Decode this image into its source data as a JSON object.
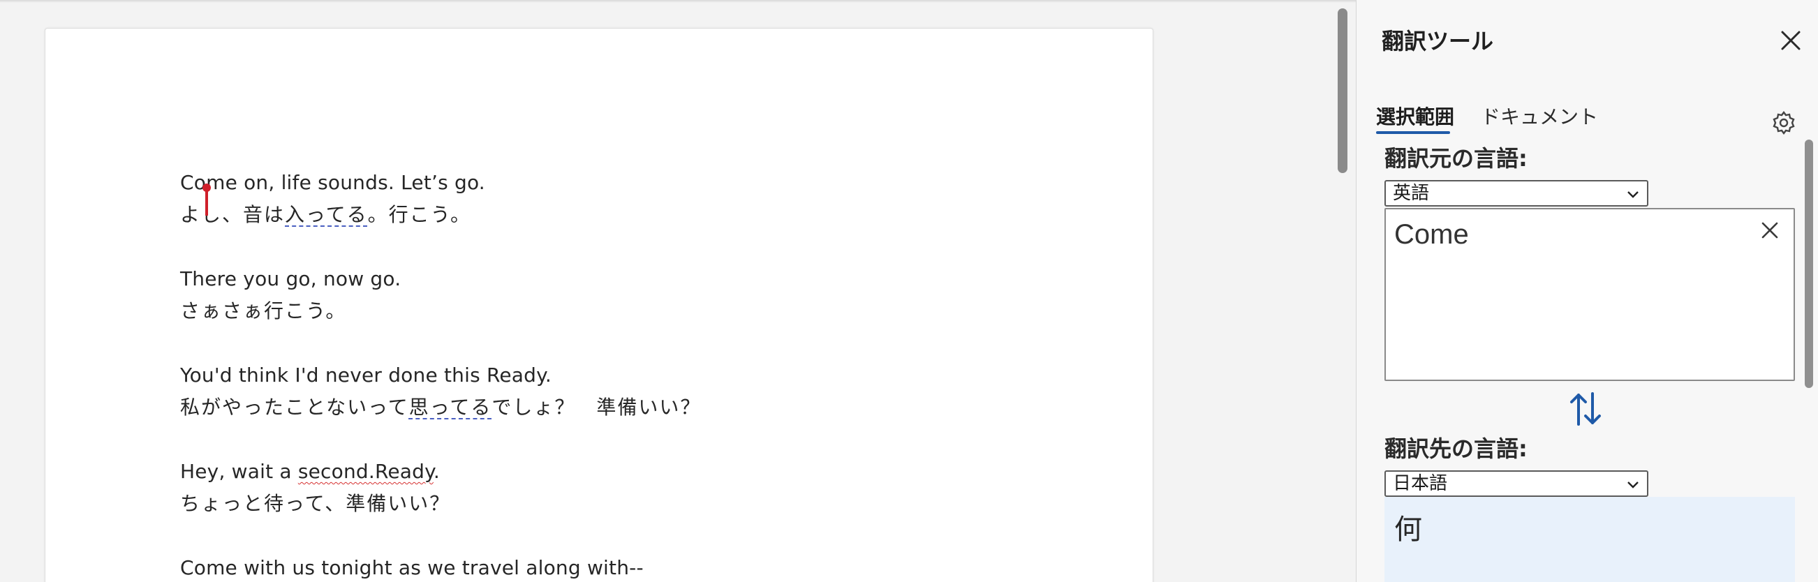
{
  "document": {
    "lines": [
      {
        "id": "l1",
        "parts": [
          "Co",
          "me on, life sounds. Let’s go."
        ]
      },
      {
        "id": "l2",
        "parts": [
          "よし、音は",
          "入ってる",
          "。行こう。"
        ]
      },
      {
        "id": "l3",
        "parts": [
          "There you go, now go."
        ]
      },
      {
        "id": "l4",
        "parts": [
          "さぁさぁ行こう。"
        ]
      },
      {
        "id": "l5",
        "parts": [
          "You'd think I'd never done this Ready."
        ]
      },
      {
        "id": "l6",
        "parts": [
          "私がやったことないって",
          "思ってる",
          "でしょ？　準備いい？"
        ]
      },
      {
        "id": "l7",
        "parts": [
          "Hey, wait a ",
          "second.Ready",
          "."
        ]
      },
      {
        "id": "l8",
        "parts": [
          "ちょっと待って、準備いい？"
        ]
      },
      {
        "id": "l9",
        "parts": [
          "Come with us tonight as we travel along with--"
        ]
      }
    ]
  },
  "pane": {
    "title": "翻訳ツール",
    "tabs": [
      {
        "label": "選択範囲",
        "active": true
      },
      {
        "label": "ドキュメント",
        "active": false
      }
    ],
    "source_label": "翻訳元の言語:",
    "source_language": "英語",
    "source_text": "Come",
    "target_label": "翻訳先の言語:",
    "target_language": "日本語",
    "target_text": "何"
  },
  "icons": {
    "close": "close-icon",
    "settings": "gear-icon",
    "clear": "clear-icon",
    "swap": "swap-arrows-icon",
    "dropdown": "chevron-down-icon"
  },
  "colors": {
    "accent": "#1f5aa8",
    "cursor": "#cf1f2a",
    "spell_error": "#d63030",
    "grammar_hint": "#4a5fc1",
    "target_bg": "#e8f1fb"
  }
}
